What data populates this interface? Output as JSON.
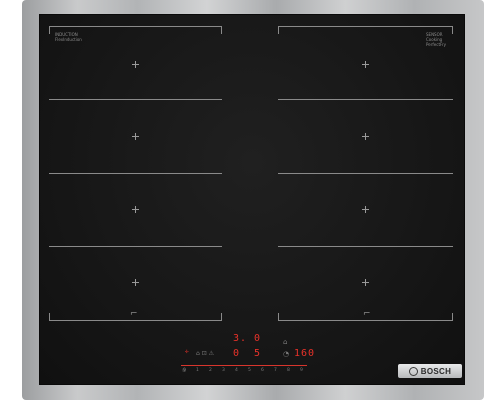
{
  "brand": {
    "name": "BOSCH"
  },
  "glass_labels": {
    "left_top": "INDUCTION",
    "left_sub": "FlexInduction",
    "right_top": "SENSOR",
    "right_mid": "Cooking",
    "right_sub": "PerfectFry"
  },
  "display": {
    "top_pair": "3. 0",
    "bottom_left": "0",
    "bottom_mid": "5",
    "timer": "160",
    "left_indicators": "⌂  ⊡  ⚠",
    "scale_icon": "①",
    "scale": [
      "0",
      "1",
      "2",
      "3",
      "4",
      "5",
      "6",
      "7",
      "8",
      "9"
    ]
  },
  "icons": [
    "plus-marker-icon",
    "pan-hook-icon",
    "power-icon",
    "lock-icon",
    "timer-icon",
    "bosch-logo-icon"
  ]
}
